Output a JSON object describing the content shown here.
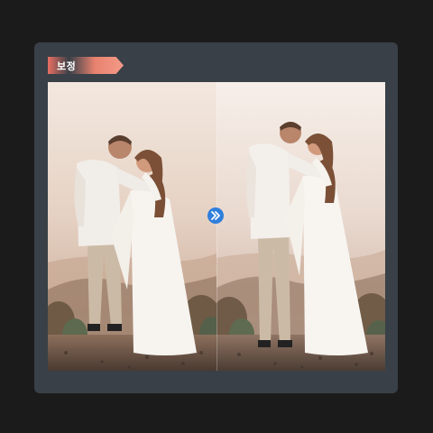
{
  "badge": {
    "label": "보정"
  },
  "compare": {
    "before_label": "",
    "after_label": "",
    "divider_icon": "double-chevron-right-icon"
  },
  "colors": {
    "background": "#1b1b1c",
    "frame": "#394047",
    "badge_accent": "#e96f62",
    "arrow": "#2f7fdc"
  }
}
